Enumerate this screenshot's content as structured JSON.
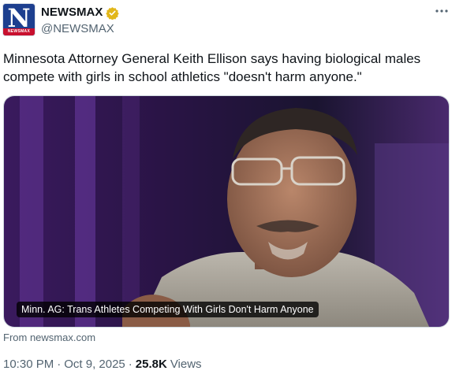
{
  "author": {
    "display_name": "NEWSMAX",
    "handle": "@NEWSMAX",
    "avatar_letter": "N",
    "avatar_caption": "NEWSMAX",
    "verified_color": "#e2b719"
  },
  "tweet": {
    "text": "Minnesota Attorney General Keith Ellison says having biological males compete with girls in school athletics \"doesn't harm anyone.\"",
    "more_icon": "more-icon"
  },
  "card": {
    "headline": "Minn. AG: Trans Athletes Competing With Girls Don't Harm Anyone",
    "source": "From newsmax.com"
  },
  "meta": {
    "time": "10:30 PM",
    "separator": "·",
    "date": "Oct 9, 2025",
    "separator2": "·",
    "views_count": "25.8K",
    "views_label": "Views"
  },
  "colors": {
    "brand_blue": "#1d3f8f",
    "brand_red": "#c8102e",
    "muted_text": "#536471",
    "text": "#0f1419"
  }
}
